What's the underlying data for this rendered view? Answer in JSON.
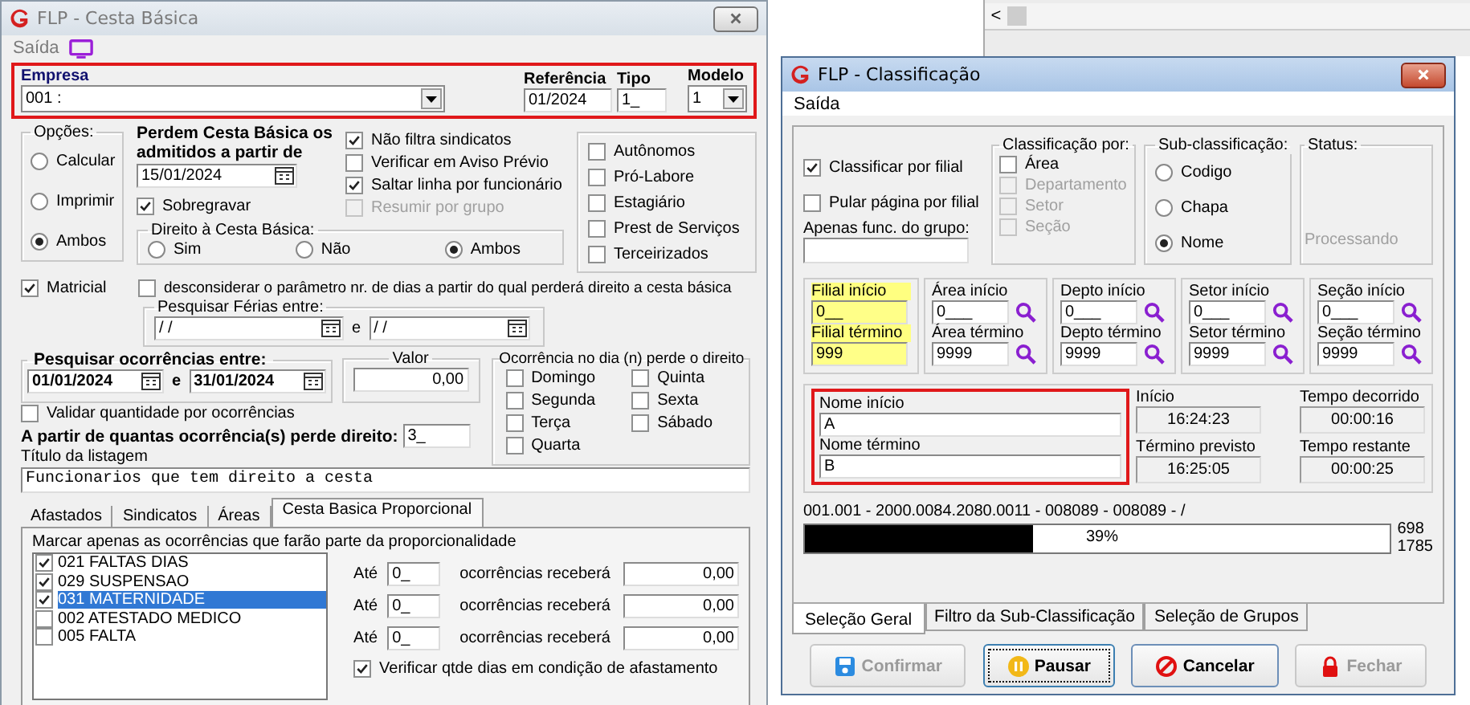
{
  "background_window": {
    "scroll_button": "<"
  },
  "cesta": {
    "title": "FLP - Cesta Básica",
    "menu": [
      {
        "label": "Saída"
      }
    ],
    "empresa": {
      "label": "Empresa",
      "value": "001 :"
    },
    "referencia": {
      "label": "Referência",
      "value": "01/2024"
    },
    "tipo": {
      "label": "Tipo",
      "value": "1_"
    },
    "modelo": {
      "label": "Modelo",
      "value": "1"
    },
    "opcoes": {
      "label": "Opções:",
      "items": [
        {
          "label": "Calcular",
          "selected": false
        },
        {
          "label": "Imprimir",
          "selected": false
        },
        {
          "label": "Ambos",
          "selected": true
        }
      ]
    },
    "perdem": {
      "label": "Perdem Cesta Básica os admitidos a partir de",
      "value": "15/01/2024"
    },
    "sobregravar": {
      "label": "Sobregravar",
      "checked": true
    },
    "flags": [
      {
        "label": "Não filtra sindicatos",
        "checked": true,
        "disabled": false
      },
      {
        "label": "Verificar em Aviso Prévio",
        "checked": false,
        "disabled": false
      },
      {
        "label": "Saltar linha por funcionário",
        "checked": true,
        "disabled": false
      },
      {
        "label": "Resumir por grupo",
        "checked": false,
        "disabled": true
      }
    ],
    "direito": {
      "label": "Direito à Cesta Básica:",
      "options": [
        {
          "label": "Sim",
          "selected": false
        },
        {
          "label": "Não",
          "selected": false
        },
        {
          "label": "Ambos",
          "selected": true
        }
      ]
    },
    "categorias": [
      {
        "label": "Autônomos",
        "checked": false
      },
      {
        "label": "Pró-Labore",
        "checked": false
      },
      {
        "label": "Estagiário",
        "checked": false
      },
      {
        "label": "Prest de Serviços",
        "checked": false
      },
      {
        "label": "Terceirizados",
        "checked": false
      }
    ],
    "matricial": {
      "label": "Matricial",
      "checked": true
    },
    "desconsiderar": {
      "label": "desconsiderar o parâmetro nr. de dias a partir do qual perderá direito a cesta básica",
      "checked": false
    },
    "ferias": {
      "label": "Pesquisar Férias entre:",
      "from": "/ /",
      "joiner": "e",
      "to": "/ /"
    },
    "ocorrencias": {
      "label": "Pesquisar ocorrências entre:",
      "from": "01/01/2024",
      "joiner": "e",
      "to": "31/01/2024"
    },
    "valor": {
      "label": "Valor",
      "value": "0,00"
    },
    "dias": {
      "label": "Ocorrência no dia (n) perde o direito",
      "items": [
        {
          "label": "Domingo",
          "checked": false
        },
        {
          "label": "Segunda",
          "checked": false
        },
        {
          "label": "Terça",
          "checked": false
        },
        {
          "label": "Quarta",
          "checked": false
        },
        {
          "label": "Quinta",
          "checked": false
        },
        {
          "label": "Sexta",
          "checked": false
        },
        {
          "label": "Sábado",
          "checked": false
        }
      ]
    },
    "validar": {
      "label": "Validar quantidade por ocorrências",
      "checked": false
    },
    "limite": {
      "label": "A partir de quantas ocorrência(s) perde direito:",
      "value": "3_"
    },
    "titulo": {
      "label": "Título da listagem",
      "value": "Funcionarios que tem direito a cesta"
    },
    "tabs": [
      {
        "label": "Afastados",
        "selected": false
      },
      {
        "label": "Sindicatos",
        "selected": false
      },
      {
        "label": "Áreas",
        "selected": false
      },
      {
        "label": "Cesta Basica Proporcional",
        "selected": true
      }
    ],
    "proporcional": {
      "hint": "Marcar apenas as ocorrências que farão parte da proporcionalidade",
      "ocorrencias": [
        {
          "label": "021 FALTAS DIAS",
          "checked": true,
          "selected": false
        },
        {
          "label": "029 SUSPENSAO",
          "checked": true,
          "selected": false
        },
        {
          "label": "031 MATERNIDADE",
          "checked": true,
          "selected": true
        },
        {
          "label": "002 ATESTADO MEDICO",
          "checked": false,
          "selected": false
        },
        {
          "label": "005 FALTA",
          "checked": false,
          "selected": false
        }
      ],
      "faixas": [
        {
          "prefix": "Até",
          "count": "0_",
          "middle": "ocorrências receberá",
          "amount": "0,00"
        },
        {
          "prefix": "Até",
          "count": "0_",
          "middle": "ocorrências receberá",
          "amount": "0,00"
        },
        {
          "prefix": "Até",
          "count": "0_",
          "middle": "ocorrências receberá",
          "amount": "0,00"
        }
      ],
      "verificar": {
        "label": "Verificar qtde dias em condição de afastamento",
        "checked": true
      }
    }
  },
  "classificacao": {
    "title": "FLP - Classificação",
    "menu": [
      {
        "label": "Saída"
      }
    ],
    "opcoes": [
      {
        "label": "Classificar por filial",
        "checked": true
      },
      {
        "label": "Pular página por filial",
        "checked": false
      }
    ],
    "grupo": {
      "label": "Apenas func. do grupo:"
    },
    "classificar_por": {
      "label": "Classificação  por:",
      "items": [
        {
          "label": "Área",
          "checked": false,
          "disabled": false
        },
        {
          "label": "Departamento",
          "checked": false,
          "disabled": true
        },
        {
          "label": "Setor",
          "checked": false,
          "disabled": true
        },
        {
          "label": "Seção",
          "checked": false,
          "disabled": true
        }
      ]
    },
    "sub": {
      "label": "Sub-classificação:",
      "items": [
        {
          "label": "Codigo",
          "selected": false
        },
        {
          "label": "Chapa",
          "selected": false
        },
        {
          "label": "Nome",
          "selected": true
        }
      ]
    },
    "status": {
      "label": "Status:",
      "value": "Processando"
    },
    "faixas": [
      {
        "start_label": "Filial início",
        "start": "0__",
        "end_label": "Filial término",
        "end": "999",
        "highlighted": true,
        "search": false
      },
      {
        "start_label": "Área início",
        "start": "0___",
        "end_label": "Área término",
        "end": "9999",
        "highlighted": false,
        "search": true
      },
      {
        "start_label": "Depto início",
        "start": "0___",
        "end_label": "Depto término",
        "end": "9999",
        "highlighted": false,
        "search": true
      },
      {
        "start_label": "Setor início",
        "start": "0___",
        "end_label": "Setor término",
        "end": "9999",
        "highlighted": false,
        "search": true
      },
      {
        "start_label": "Seção início",
        "start": "0___",
        "end_label": "Seção término",
        "end": "9999",
        "highlighted": false,
        "search": true
      }
    ],
    "nome": {
      "start_label": "Nome início",
      "start": "A",
      "end_label": "Nome término",
      "end": "B"
    },
    "tempos": [
      {
        "label": "Início",
        "value": "16:24:23"
      },
      {
        "label": "Tempo decorrido",
        "value": "00:00:16"
      },
      {
        "label": "Término previsto",
        "value": "16:25:05"
      },
      {
        "label": "Tempo restante",
        "value": "00:00:25"
      }
    ],
    "registro": "001.001 - 2000.0084.2080.0011 - 008089 - 008089 - /",
    "progresso": {
      "level": 0.39,
      "text": "39%",
      "current": "698",
      "total": "1785"
    },
    "tabs": [
      {
        "label": "Seleção Geral",
        "selected": true
      },
      {
        "label": "Filtro da Sub-Classificação",
        "selected": false
      },
      {
        "label": "Seleção de Grupos",
        "selected": false
      }
    ],
    "buttons": [
      {
        "label": "Confirmar",
        "kind": "save",
        "disabled": true,
        "focused": false
      },
      {
        "label": "Pausar",
        "kind": "pause",
        "disabled": false,
        "focused": true
      },
      {
        "label": "Cancelar",
        "kind": "cancel",
        "disabled": false,
        "focused": false
      },
      {
        "label": "Fechar",
        "kind": "lock",
        "disabled": true,
        "focused": false
      }
    ]
  }
}
